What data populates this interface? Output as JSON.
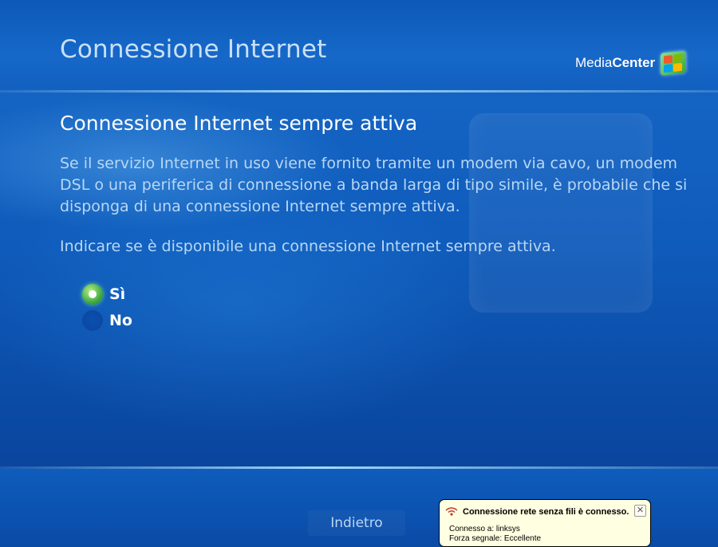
{
  "header": {
    "title": "Connessione Internet",
    "logo_prefix": "Media",
    "logo_bold": "Center"
  },
  "content": {
    "heading": "Connessione Internet sempre attiva",
    "description": "Se il servizio Internet in uso viene fornito tramite un modem via cavo, un modem DSL o una periferica di connessione a banda larga di tipo simile, è probabile che si disponga di una connessione Internet sempre attiva.",
    "question": "Indicare se è disponibile una connessione Internet sempre attiva.",
    "options": [
      {
        "label": "Sì",
        "selected": true
      },
      {
        "label": "No",
        "selected": false
      }
    ]
  },
  "footer": {
    "back_label": "Indietro"
  },
  "notification": {
    "icon": "wireless-network-icon",
    "title": "Connessione rete senza fili è connesso.",
    "close_glyph": "✕",
    "line1": "Connesso a: linksys",
    "line2": "Forza segnale: Eccellente"
  },
  "colors": {
    "background": "#0f5bbb",
    "accent_text": "#b9d7f4",
    "selected_radio": "#3ca63c",
    "balloon_bg": "#ffffe1"
  }
}
